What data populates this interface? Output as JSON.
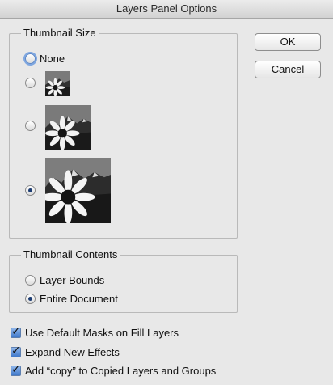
{
  "window": {
    "title": "Layers Panel Options"
  },
  "buttons": {
    "ok": "OK",
    "cancel": "Cancel"
  },
  "thumbnail_size": {
    "legend": "Thumbnail Size",
    "options": [
      {
        "label": "None",
        "selected": false
      },
      {
        "label": "",
        "size": "small",
        "selected": false
      },
      {
        "label": "",
        "size": "medium",
        "selected": false
      },
      {
        "label": "",
        "size": "large",
        "selected": true
      }
    ]
  },
  "thumbnail_contents": {
    "legend": "Thumbnail Contents",
    "options": [
      {
        "label": "Layer Bounds",
        "selected": false
      },
      {
        "label": "Entire Document",
        "selected": true
      }
    ]
  },
  "checkboxes": [
    {
      "label": "Use Default Masks on Fill Layers",
      "checked": true
    },
    {
      "label": "Expand New Effects",
      "checked": true
    },
    {
      "label": "Add “copy” to Copied Layers and Groups",
      "checked": true
    }
  ],
  "colors": {
    "accent": "#3f78c9",
    "background": "#e8e8e8"
  }
}
